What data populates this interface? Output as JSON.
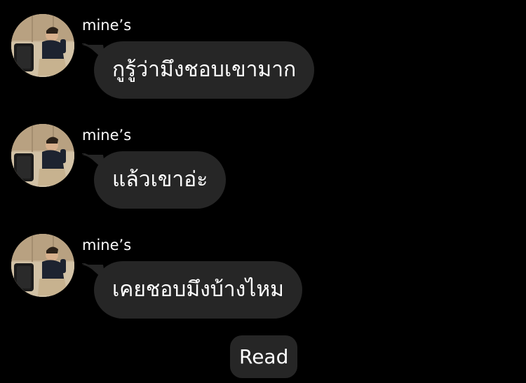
{
  "conversation": {
    "messages": [
      {
        "sender": "mine’s",
        "text": "กูรู้ว่ามึงชอบเขามาก",
        "avatar_icon": "profile-photo-avatar"
      },
      {
        "sender": "mine’s",
        "text": "แล้วเขาอ่ะ",
        "avatar_icon": "profile-photo-avatar"
      },
      {
        "sender": "mine’s",
        "text": "เคยชอบมึงบ้างไหม",
        "avatar_icon": "profile-photo-avatar"
      }
    ],
    "read_receipt": "Read"
  },
  "theme": {
    "background": "#000000",
    "bubble_color": "#262626",
    "text_color": "#ffffff"
  }
}
